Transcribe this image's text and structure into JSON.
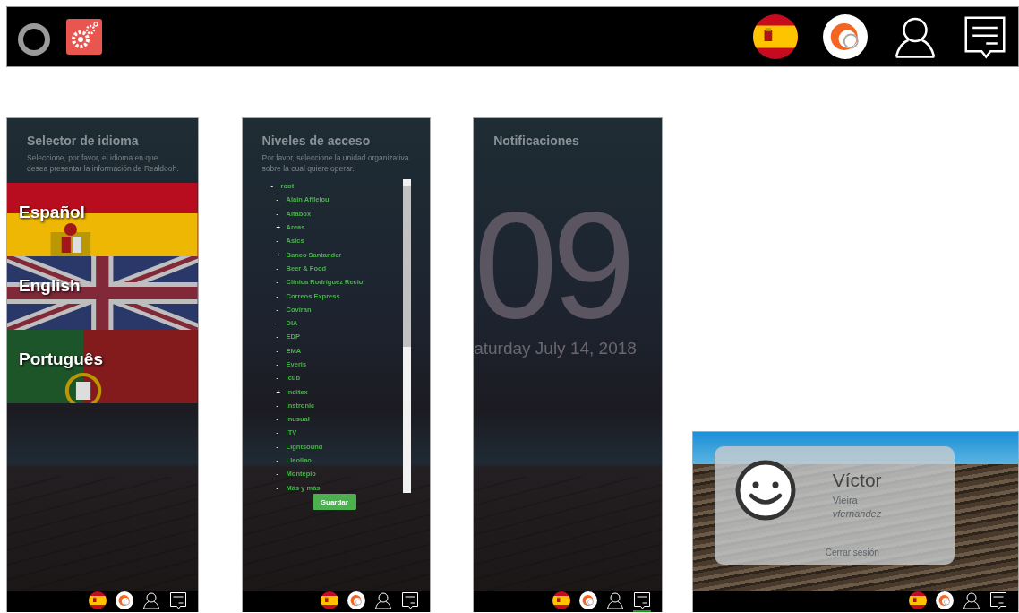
{
  "top_bar": {
    "left": [
      {
        "kind": "ring"
      },
      {
        "kind": "gears"
      }
    ],
    "right": [
      {
        "kind": "flag"
      },
      {
        "kind": "logo"
      },
      {
        "kind": "user"
      },
      {
        "kind": "messages"
      }
    ]
  },
  "language_panel": {
    "title": "Selector de idioma",
    "description": "Seleccione, por favor, el idioma en que desea presentar la información de Realdooh.",
    "languages": [
      {
        "label": "Español",
        "kind": "es"
      },
      {
        "label": "English",
        "kind": "en"
      },
      {
        "label": "Português",
        "kind": "pt"
      }
    ],
    "footer_nav": [
      {
        "kind": "flag",
        "selected": false
      },
      {
        "kind": "logo",
        "selected": false
      },
      {
        "kind": "user",
        "selected": false
      },
      {
        "kind": "messages",
        "selected": false
      }
    ]
  },
  "access_panel": {
    "title": "Niveles de acceso",
    "description": "Por favor, seleccione la unidad organizativa sobre la cual quiere operar.",
    "tree": [
      {
        "sign": "-",
        "label": "root",
        "children": [
          {
            "sign": "-",
            "label": "Alain Afflelou"
          },
          {
            "sign": "-",
            "label": "Altabox"
          },
          {
            "sign": "+",
            "label": "Areas"
          },
          {
            "sign": "-",
            "label": "Asics"
          },
          {
            "sign": "+",
            "label": "Banco Santander"
          },
          {
            "sign": "-",
            "label": "Beer & Food"
          },
          {
            "sign": "-",
            "label": "Clínica Rodríguez Recio"
          },
          {
            "sign": "-",
            "label": "Correos Express"
          },
          {
            "sign": "-",
            "label": "Coviran"
          },
          {
            "sign": "-",
            "label": "DIA"
          },
          {
            "sign": "-",
            "label": "EDP"
          },
          {
            "sign": "-",
            "label": "EMA"
          },
          {
            "sign": "-",
            "label": "Everis"
          },
          {
            "sign": "-",
            "label": "icub"
          },
          {
            "sign": "+",
            "label": "Inditex"
          },
          {
            "sign": "-",
            "label": "Instronic"
          },
          {
            "sign": "-",
            "label": "Inusual"
          },
          {
            "sign": "-",
            "label": "ITV"
          },
          {
            "sign": "-",
            "label": "Lightsound"
          },
          {
            "sign": "-",
            "label": "Llaollao"
          },
          {
            "sign": "-",
            "label": "Montepio"
          },
          {
            "sign": "-",
            "label": "Más y más"
          }
        ]
      }
    ],
    "save_button": "Guardar",
    "footer_nav": [
      {
        "kind": "flag",
        "selected": false
      },
      {
        "kind": "logo",
        "selected": false
      },
      {
        "kind": "user",
        "selected": false
      },
      {
        "kind": "messages",
        "selected": false
      }
    ]
  },
  "notifications_panel": {
    "title": "Notificaciones",
    "clock": {
      "time": "09",
      "date": "aturday July 14, 2018"
    },
    "footer_nav": [
      {
        "kind": "flag",
        "selected": false
      },
      {
        "kind": "logo",
        "selected": false
      },
      {
        "kind": "user",
        "selected": false
      },
      {
        "kind": "messages",
        "selected": true
      }
    ]
  },
  "profile_panel": {
    "user": {
      "first_name": "Víctor",
      "last_name": "Vieira",
      "username": "vfernandez",
      "logout": "Cerrar sesión"
    },
    "footer_nav": [
      {
        "kind": "flag",
        "selected": false
      },
      {
        "kind": "logo",
        "selected": false
      },
      {
        "kind": "user",
        "selected": false
      },
      {
        "kind": "messages",
        "selected": false
      }
    ]
  }
}
